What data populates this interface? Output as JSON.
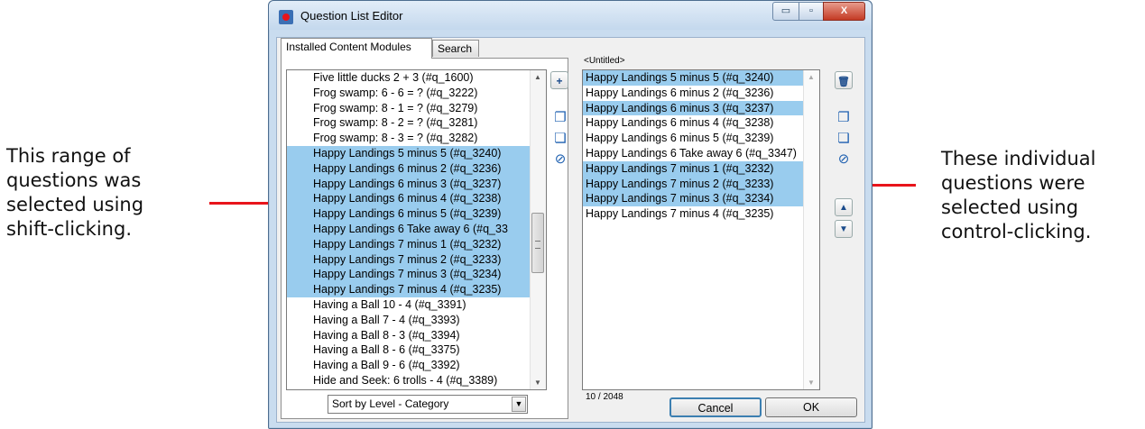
{
  "window": {
    "title": "Question List Editor",
    "minimize_glyph": "▭",
    "maximize_glyph": "▫",
    "close_glyph": "X"
  },
  "tabs": [
    {
      "label": "Installed Content Modules",
      "active": true
    },
    {
      "label": "Search",
      "active": false
    }
  ],
  "left_list": {
    "items": [
      {
        "label": "Five little ducks 2 + 3 (#q_1600)",
        "selected": false
      },
      {
        "label": "Frog swamp: 6 - 6 = ? (#q_3222)",
        "selected": false
      },
      {
        "label": "Frog swamp: 8 - 1 = ? (#q_3279)",
        "selected": false
      },
      {
        "label": "Frog swamp: 8 - 2 = ? (#q_3281)",
        "selected": false
      },
      {
        "label": "Frog swamp: 8 - 3 = ? (#q_3282)",
        "selected": false
      },
      {
        "label": "Happy Landings 5 minus 5 (#q_3240)",
        "selected": true
      },
      {
        "label": "Happy Landings 6 minus 2 (#q_3236)",
        "selected": true
      },
      {
        "label": "Happy Landings 6 minus 3 (#q_3237)",
        "selected": true
      },
      {
        "label": "Happy Landings 6 minus 4 (#q_3238)",
        "selected": true
      },
      {
        "label": "Happy Landings 6 minus 5 (#q_3239)",
        "selected": true
      },
      {
        "label": "Happy Landings 6 Take away 6 (#q_33",
        "selected": true
      },
      {
        "label": "Happy Landings 7 minus 1 (#q_3232)",
        "selected": true
      },
      {
        "label": "Happy Landings 7 minus 2 (#q_3233)",
        "selected": true
      },
      {
        "label": "Happy Landings 7 minus 3 (#q_3234)",
        "selected": true
      },
      {
        "label": "Happy Landings 7 minus 4 (#q_3235)",
        "selected": true
      },
      {
        "label": "Having a Ball 10 - 4 (#q_3391)",
        "selected": false
      },
      {
        "label": "Having a Ball 7 - 4 (#q_3393)",
        "selected": false
      },
      {
        "label": "Having a Ball 8 - 3 (#q_3394)",
        "selected": false
      },
      {
        "label": "Having a Ball 8 - 6 (#q_3375)",
        "selected": false
      },
      {
        "label": "Having a Ball 9 - 6 (#q_3392)",
        "selected": false
      },
      {
        "label": "Hide and Seek: 6 trolls - 4 (#q_3389)",
        "selected": false
      }
    ]
  },
  "right_list": {
    "title": "<Untitled>",
    "items": [
      {
        "label": "Happy Landings 5 minus 5 (#q_3240)",
        "selected": true
      },
      {
        "label": "Happy Landings 6 minus 2 (#q_3236)",
        "selected": false
      },
      {
        "label": "Happy Landings 6 minus 3 (#q_3237)",
        "selected": true
      },
      {
        "label": "Happy Landings 6 minus 4 (#q_3238)",
        "selected": false
      },
      {
        "label": "Happy Landings 6 minus 5 (#q_3239)",
        "selected": false
      },
      {
        "label": "Happy Landings 6 Take away 6 (#q_3347)",
        "selected": false
      },
      {
        "label": "Happy Landings 7 minus 1 (#q_3232)",
        "selected": true
      },
      {
        "label": "Happy Landings 7 minus 2 (#q_3233)",
        "selected": true
      },
      {
        "label": "Happy Landings 7 minus 3 (#q_3234)",
        "selected": true
      },
      {
        "label": "Happy Landings 7 minus 4 (#q_3235)",
        "selected": false
      }
    ],
    "counter": "10 / 2048"
  },
  "tools": {
    "add_glyph": "+",
    "copy_glyph": "❐",
    "paste_glyph": "❏",
    "no_glyph": "⊘",
    "trash_glyph": "🗑",
    "up_glyph": "▲",
    "down_glyph": "▼"
  },
  "sort_select": {
    "value": "Sort by Level - Category",
    "arrow": "▼"
  },
  "buttons": {
    "cancel": "Cancel",
    "ok": "OK"
  },
  "annotations": {
    "left": [
      "This range of",
      "questions was",
      "selected using",
      "shift-clicking."
    ],
    "right": [
      "These individual",
      "questions were",
      "selected using",
      "control-clicking."
    ]
  },
  "colors": {
    "selection": "#99ccee",
    "arrow": "#e8141b"
  }
}
